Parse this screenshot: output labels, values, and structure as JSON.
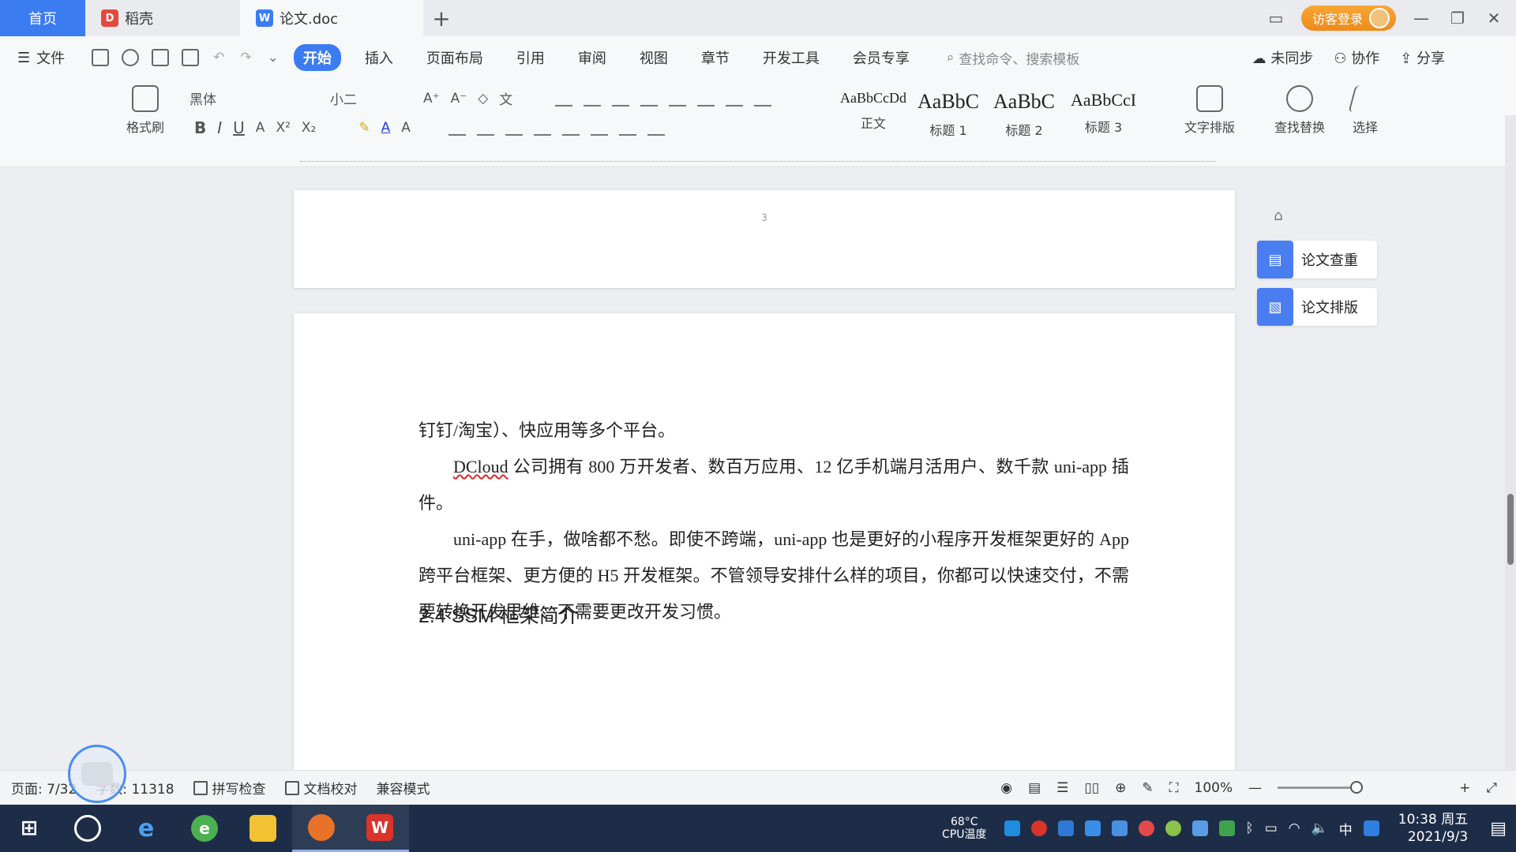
{
  "tabs": {
    "home": "首页",
    "docer": "稻壳",
    "doc": "论文.doc"
  },
  "titlebar": {
    "login": "访客登录"
  },
  "menu": {
    "file": "文件",
    "items": [
      "开始",
      "插入",
      "页面布局",
      "引用",
      "审阅",
      "视图",
      "章节",
      "开发工具",
      "会员专享"
    ],
    "search_placeholder": "查找命令、搜索模板",
    "sync": "未同步",
    "collab": "协作",
    "share": "分享"
  },
  "ribbon": {
    "font_name": "黑体",
    "font_size": "小二",
    "format_painter": "格式刷",
    "styles": [
      {
        "sample": "AaBbCcDd",
        "label": "正文"
      },
      {
        "sample": "AaBbC",
        "label": "标题 1"
      },
      {
        "sample": "AaBbC",
        "label": "标题 2"
      },
      {
        "sample": "AaBbCcI",
        "label": "标题 3"
      }
    ],
    "text_layout": "文字排版",
    "find_replace": "查找替换",
    "select": "选择"
  },
  "document": {
    "page_number": "3",
    "line1": "钉钉/淘宝）、快应用等多个平台。",
    "para1_lead": "DCloud",
    "para1_rest": " 公司拥有 800 万开发者、数百万应用、12 亿手机端月活用户、数千款 uni-app 插件。",
    "para2": "uni-app 在手，做啥都不愁。即使不跨端，uni-app 也是更好的小程序开发框架更好的 App 跨平台框架、更方便的 H5 开发框架。不管领导安排什么样的项目，你都可以快速交付，不需要转换开发思维、不需要更改开发习惯。",
    "heading": "2.4 SSM 框架简介"
  },
  "side_panel": {
    "check": "论文查重",
    "format": "论文排版"
  },
  "statusbar": {
    "page": "页面: 7/32",
    "words": "字数: 11318",
    "spell": "拼写检查",
    "proof": "文档校对",
    "compat": "兼容模式",
    "zoom": "100%"
  },
  "taskbar": {
    "cpu_temp": "68°C",
    "cpu_label": "CPU温度",
    "ime": "中",
    "time": "10:38 周五",
    "date": "2021/9/3"
  }
}
